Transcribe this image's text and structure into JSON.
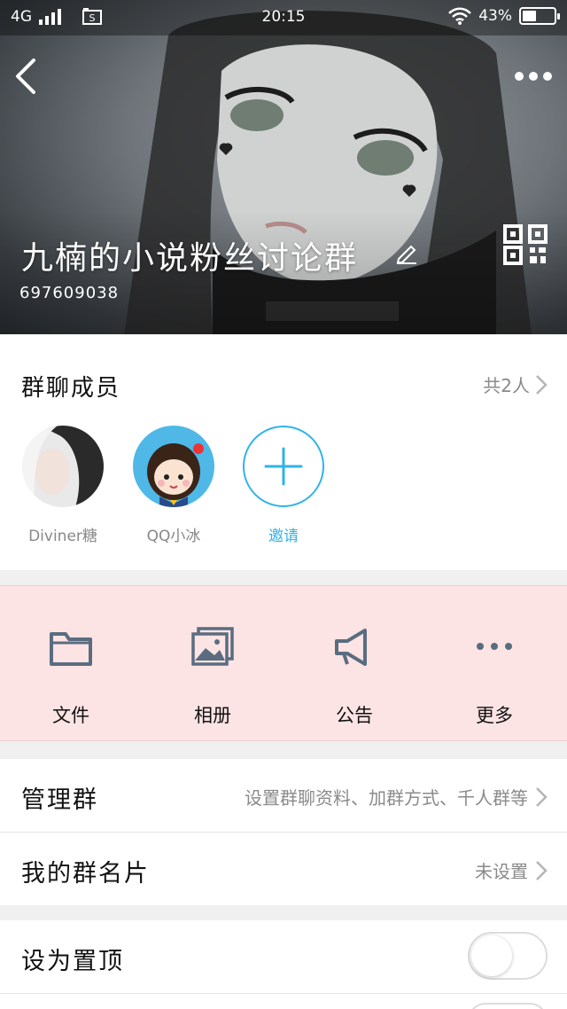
{
  "status_bar": {
    "network": "4G",
    "time": "20:15",
    "battery_text": "43%",
    "battery_level": 0.43
  },
  "header": {
    "group_name": "九楠的小说粉丝讨论群",
    "group_number": "697609038",
    "back_icon": "chevron-left-icon",
    "more_icon": "more-dots-icon",
    "qr_icon": "qr-code-icon",
    "edit_icon": "pencil-icon"
  },
  "members": {
    "title": "群聊成员",
    "count_text": "共2人",
    "list": [
      {
        "name": "Diviner糖"
      },
      {
        "name": "QQ小冰"
      }
    ],
    "invite_label": "邀请"
  },
  "actions": [
    {
      "label": "文件",
      "icon": "folder-icon"
    },
    {
      "label": "相册",
      "icon": "album-icon"
    },
    {
      "label": "公告",
      "icon": "megaphone-icon"
    },
    {
      "label": "更多",
      "icon": "more-horizontal-icon"
    }
  ],
  "settings": {
    "manage": {
      "label": "管理群",
      "value": "设置群聊资料、加群方式、千人群等"
    },
    "card": {
      "label": "我的群名片",
      "value": "未设置"
    },
    "pin": {
      "label": "设为置顶",
      "on": false
    }
  },
  "colors": {
    "accent": "#2fb3e8",
    "actions_bg": "#fde4e4",
    "muted_text": "#8a8a8a"
  }
}
